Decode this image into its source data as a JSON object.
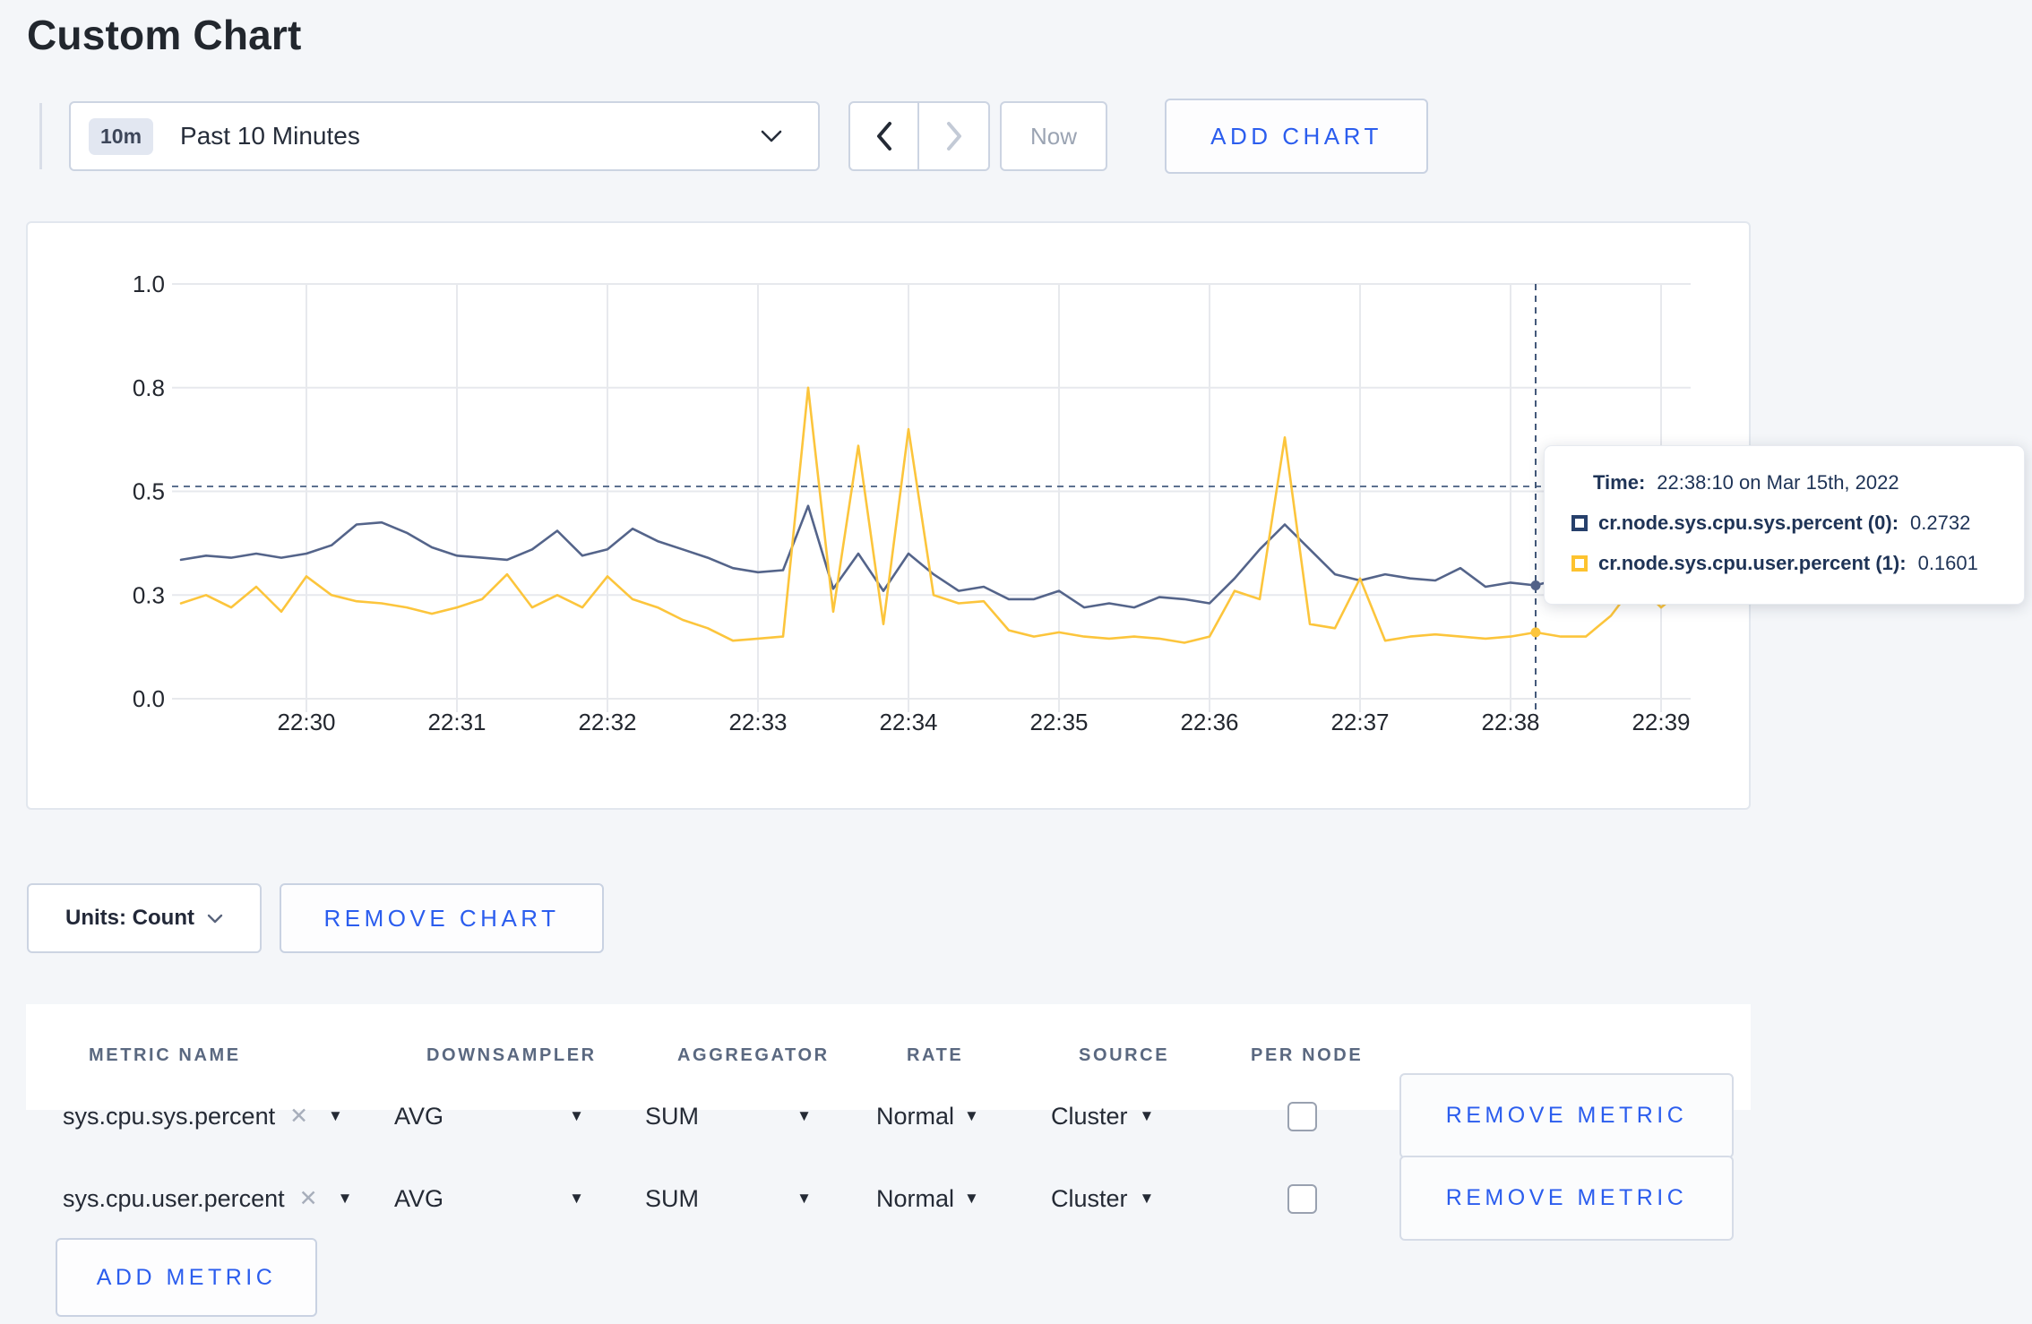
{
  "page": {
    "title": "Custom Chart",
    "background": "#f4f6f9",
    "accent_blue": "#2b5dee"
  },
  "toolbar": {
    "time_badge": "10m",
    "time_label": "Past 10 Minutes",
    "now_label": "Now",
    "add_chart_label": "ADD CHART"
  },
  "chart_controls": {
    "units_label": "Units: Count",
    "remove_chart_label": "REMOVE CHART"
  },
  "tooltip": {
    "time_label": "Time:",
    "time_value": "22:38:10 on Mar 15th, 2022",
    "series": [
      {
        "label": "cr.node.sys.cpu.sys.percent (0):",
        "value": "0.2732",
        "color": "#27406b"
      },
      {
        "label": "cr.node.sys.cpu.user.percent (1):",
        "value": "0.1601",
        "color": "#fdc32f"
      }
    ]
  },
  "chart_data": {
    "type": "line",
    "title": "",
    "xlabel": "",
    "ylabel": "",
    "ylim": [
      0,
      1
    ],
    "grid": true,
    "legend_position": "none",
    "x_tick_labels": [
      "22:30",
      "22:31",
      "22:32",
      "22:33",
      "22:34",
      "22:35",
      "22:36",
      "22:37",
      "22:38",
      "22:39"
    ],
    "y_tick_labels": [
      "0.0",
      "0.3",
      "0.5",
      "0.8",
      "1.0"
    ],
    "y_tick_positions": [
      0,
      0.25,
      0.5,
      0.75,
      1.0
    ],
    "x_start_time": "22:29:10",
    "x_interval_seconds": 10,
    "grid_color": "#e7e9ed",
    "series": [
      {
        "name": "cr.node.sys.cpu.sys.percent",
        "color": "#54648a",
        "values": [
          0.335,
          0.345,
          0.34,
          0.35,
          0.34,
          0.35,
          0.37,
          0.42,
          0.425,
          0.4,
          0.365,
          0.345,
          0.34,
          0.335,
          0.36,
          0.405,
          0.345,
          0.36,
          0.41,
          0.38,
          0.36,
          0.34,
          0.315,
          0.305,
          0.31,
          0.465,
          0.265,
          0.35,
          0.26,
          0.35,
          0.3,
          0.26,
          0.27,
          0.24,
          0.24,
          0.26,
          0.22,
          0.23,
          0.22,
          0.245,
          0.24,
          0.23,
          0.29,
          0.36,
          0.42,
          0.36,
          0.3,
          0.285,
          0.3,
          0.29,
          0.285,
          0.315,
          0.27,
          0.28,
          0.2732,
          0.29,
          0.3,
          0.31,
          0.3,
          0.295,
          0.305
        ]
      },
      {
        "name": "cr.node.sys.cpu.user.percent",
        "color": "#fcc53c",
        "values": [
          0.23,
          0.25,
          0.22,
          0.27,
          0.21,
          0.295,
          0.25,
          0.235,
          0.23,
          0.22,
          0.205,
          0.22,
          0.24,
          0.3,
          0.22,
          0.25,
          0.22,
          0.295,
          0.24,
          0.22,
          0.19,
          0.17,
          0.14,
          0.145,
          0.15,
          0.75,
          0.21,
          0.61,
          0.18,
          0.65,
          0.25,
          0.23,
          0.235,
          0.165,
          0.15,
          0.16,
          0.15,
          0.145,
          0.15,
          0.145,
          0.135,
          0.15,
          0.26,
          0.24,
          0.63,
          0.18,
          0.17,
          0.29,
          0.14,
          0.15,
          0.155,
          0.15,
          0.145,
          0.15,
          0.1601,
          0.15,
          0.15,
          0.2,
          0.28,
          0.22,
          0.27
        ]
      }
    ],
    "crosshair": {
      "point_index": 54,
      "time": "22:38:10",
      "horizontal_fraction": 0.512
    }
  },
  "metrics_table": {
    "headers": [
      "METRIC NAME",
      "DOWNSAMPLER",
      "AGGREGATOR",
      "RATE",
      "SOURCE",
      "PER NODE"
    ],
    "rows": [
      {
        "metric": "sys.cpu.sys.percent",
        "downsampler": "AVG",
        "aggregator": "SUM",
        "rate": "Normal",
        "source": "Cluster",
        "per_node_checked": false,
        "remove_label": "REMOVE METRIC"
      },
      {
        "metric": "sys.cpu.user.percent",
        "downsampler": "AVG",
        "aggregator": "SUM",
        "rate": "Normal",
        "source": "Cluster",
        "per_node_checked": false,
        "remove_label": "REMOVE METRIC"
      }
    ],
    "add_metric_label": "ADD METRIC"
  }
}
